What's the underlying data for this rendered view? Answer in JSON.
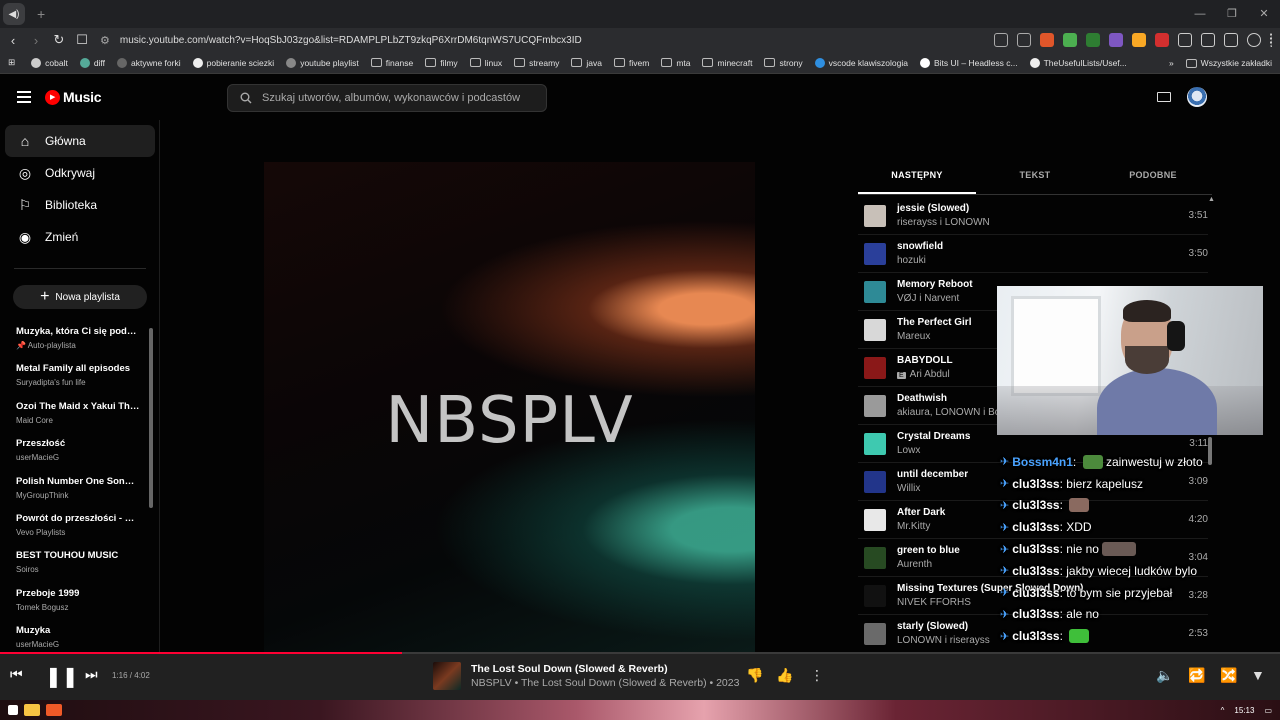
{
  "browser": {
    "url": "music.youtube.com/watch?v=HoqSbJ03zgo&list=RDAMPLPLbZT9zkqP6XrrDM6tqnWS7UCQFmbcx3ID",
    "bookmarks": [
      "cobalt",
      "diff",
      "aktywne forki",
      "pobieranie sciezki",
      "youtube playlist",
      "finanse",
      "filmy",
      "linux",
      "streamy",
      "java",
      "fivem",
      "mta",
      "minecraft",
      "strony",
      "vscode klawiszologia",
      "Bits UI – Headless c...",
      "TheUsefulLists/Usef..."
    ],
    "all_bookmarks": "Wszystkie zakładki"
  },
  "header": {
    "logo": "Music",
    "search_placeholder": "Szukaj utworów, albumów, wykonawców i podcastów"
  },
  "sidebar": {
    "nav": [
      {
        "label": "Główna",
        "icon": "home-icon"
      },
      {
        "label": "Odkrywaj",
        "icon": "compass-icon"
      },
      {
        "label": "Biblioteka",
        "icon": "bookmark-icon"
      },
      {
        "label": "Zmień",
        "icon": "radio-icon"
      }
    ],
    "new_playlist": "Nowa playlista",
    "playlists": [
      {
        "title": "Muzyka, która Ci się podoba",
        "subtitle": "Auto-playlista"
      },
      {
        "title": "Metal Family all episodes",
        "subtitle": "Suryadipta's fun life"
      },
      {
        "title": "Ozoi The Maid x Yakui The...",
        "subtitle": "Maid Core"
      },
      {
        "title": "Przeszłość",
        "subtitle": "userMacieG"
      },
      {
        "title": "Polish Number One Songs...",
        "subtitle": "MyGroupThink"
      },
      {
        "title": "Powrót do przeszłości - Hi...",
        "subtitle": "Vevo Playlists"
      },
      {
        "title": "BEST TOUHOU MUSIC",
        "subtitle": "Soiros"
      },
      {
        "title": "Przeboje 1999",
        "subtitle": "Tomek Bogusz"
      },
      {
        "title": "Muzyka",
        "subtitle": "userMacieG"
      }
    ]
  },
  "art": {
    "text": "NBSPLV"
  },
  "queue": {
    "tabs": [
      "NASTĘPNY",
      "TEKST",
      "PODOBNE"
    ],
    "items": [
      {
        "title": "jessie (Slowed)",
        "artist": "riserayss i LONOWN",
        "duration": "3:51",
        "color": "#c8c0b8"
      },
      {
        "title": "snowfield",
        "artist": "hozuki",
        "duration": "3:50",
        "color": "#2a3f9a"
      },
      {
        "title": "Memory Reboot",
        "artist": "VØJ i Narvent",
        "duration": "",
        "color": "#2e8a96"
      },
      {
        "title": "The Perfect Girl",
        "artist": "Mareux",
        "duration": "",
        "color": "#d8d8d8"
      },
      {
        "title": "BABYDOLL",
        "artist": "Ari Abdul",
        "duration": "",
        "color": "#8a1818",
        "explicit": "E"
      },
      {
        "title": "Deathwish",
        "artist": "akiaura, LONOWN i Bo",
        "duration": "",
        "color": "#9a9a9a"
      },
      {
        "title": "Crystal Dreams",
        "artist": "Lowx",
        "duration": "3:11",
        "color": "#3ec9b0"
      },
      {
        "title": "until december",
        "artist": "Willix",
        "duration": "3:09",
        "color": "#22358a"
      },
      {
        "title": "After Dark",
        "artist": "Mr.Kitty",
        "duration": "4:20",
        "color": "#e8e8e8"
      },
      {
        "title": "green to blue",
        "artist": "Aurenth",
        "duration": "3:04",
        "color": "#274a22"
      },
      {
        "title": "Missing Textures (Super Slowed Down)",
        "artist": "NIVEK FFORHS",
        "duration": "3:28",
        "color": "#111111"
      },
      {
        "title": "starly (Slowed)",
        "artist": "LONOWN i riserayss",
        "duration": "2:53",
        "color": "#6a6a6a"
      }
    ]
  },
  "chat": [
    {
      "user": "Bossm4n1",
      "user_color": "#4aa3ff",
      "message": "zainwestuj w złoto",
      "emote": "pepe"
    },
    {
      "user": "clu3l3ss",
      "user_color": "#ffffff",
      "message": "bierz kapelusz"
    },
    {
      "user": "clu3l3ss",
      "user_color": "#ffffff",
      "message": "",
      "emote": "face"
    },
    {
      "user": "clu3l3ss",
      "user_color": "#ffffff",
      "message": "XDD"
    },
    {
      "user": "clu3l3ss",
      "user_color": "#ffffff",
      "message": "nie no",
      "emote": "face-wide"
    },
    {
      "user": "clu3l3ss",
      "user_color": "#ffffff",
      "message": "jakby wiecej ludków bylo"
    },
    {
      "user": "clu3l3ss",
      "user_color": "#ffffff",
      "message": "to bym sie przyjebał"
    },
    {
      "user": "clu3l3ss",
      "user_color": "#ffffff",
      "message": "ale no"
    },
    {
      "user": "clu3l3ss",
      "user_color": "#ffffff",
      "message": "",
      "emote": "green"
    }
  ],
  "player": {
    "time": "1:16 / 4:02",
    "progress": 0.314,
    "title": "The Lost Soul Down (Slowed & Reverb)",
    "subtitle": "NBSPLV • The Lost Soul Down (Slowed & Reverb) • 2023"
  },
  "taskbar": {
    "clock": "15:13"
  }
}
